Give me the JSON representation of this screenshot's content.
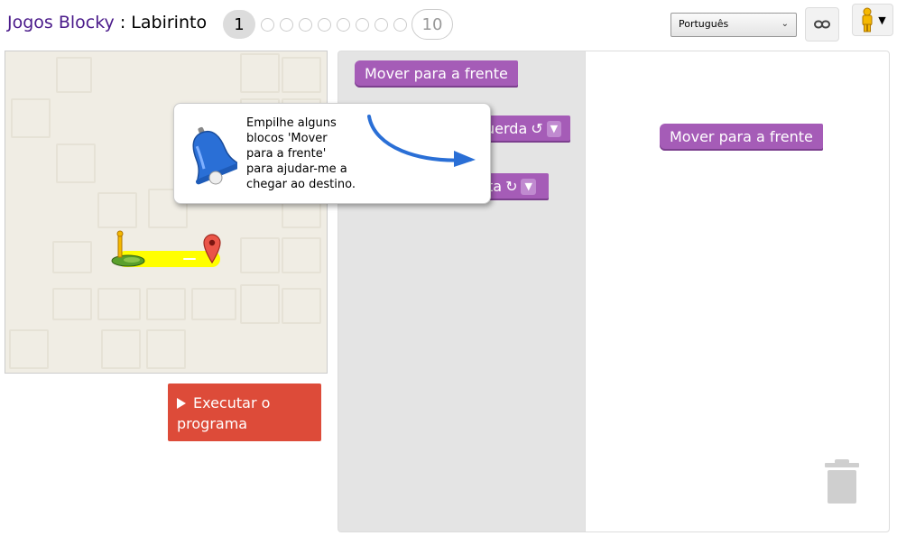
{
  "header": {
    "app_name": "Jogos Blocky",
    "separator": " : ",
    "game_name": "Labirinto",
    "level_current": "1",
    "level_last": "10",
    "language_selected": "Português"
  },
  "tooltip": {
    "line1": "Empilhe alguns",
    "line2": "blocos 'Mover",
    "line3": "para a frente'",
    "line4": "para ajudar-me a",
    "line5": "chegar ao destino."
  },
  "toolbox": {
    "block_forward": "Mover para a frente",
    "block_left_partial": "uerda",
    "block_left_symbol": "↺",
    "block_right_partial": "ta",
    "block_right_symbol": "↻",
    "dropdown_arrow": "▼"
  },
  "workspace": {
    "block_forward": "Mover para a frente"
  },
  "run_button": {
    "label_line1": "Executar o",
    "label_line2": "programa"
  },
  "colors": {
    "accent_block": "#a55cb7",
    "run_button": "#dd4b39",
    "title_app": "#4a1a8a",
    "path": "#ffff00",
    "bell": "#2a6fd6"
  },
  "icons": [
    "link-icon",
    "pegman-icon",
    "bell-icon",
    "trash-icon",
    "marker-icon",
    "play-icon"
  ]
}
